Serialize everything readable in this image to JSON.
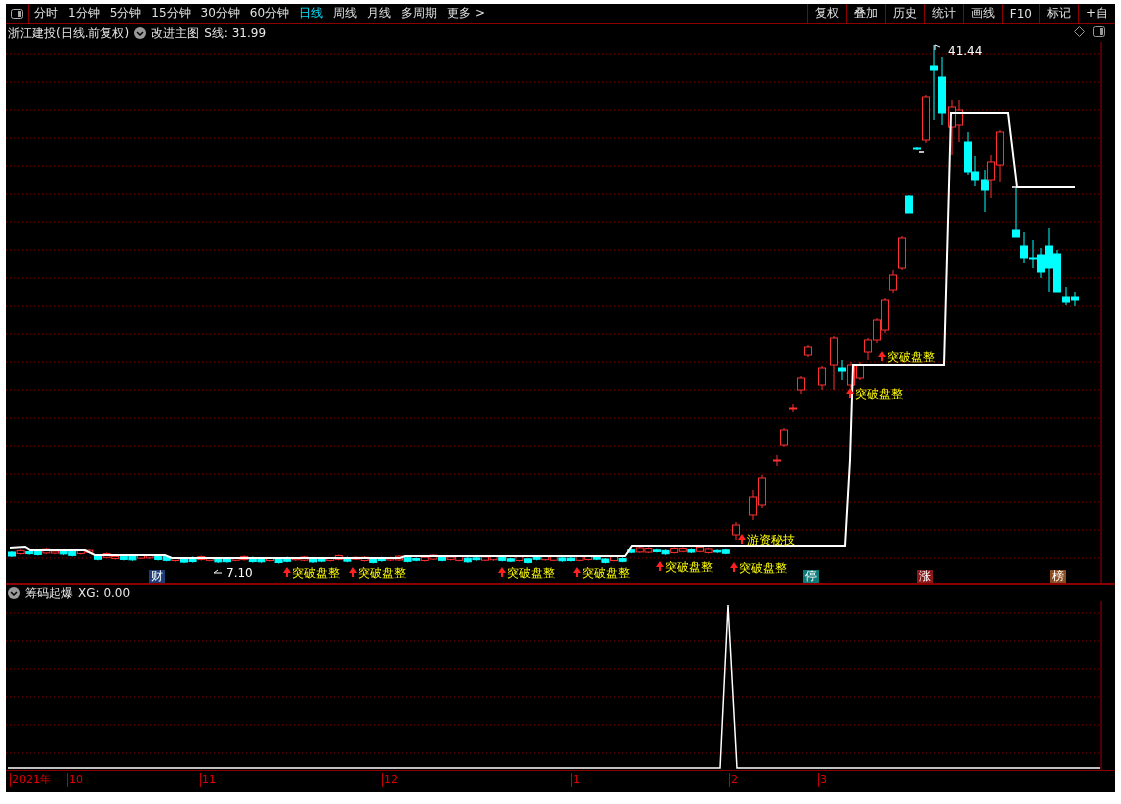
{
  "toolbar": {
    "periods": [
      {
        "label": "分时",
        "selected": false
      },
      {
        "label": "1分钟",
        "selected": false
      },
      {
        "label": "5分钟",
        "selected": false
      },
      {
        "label": "15分钟",
        "selected": false
      },
      {
        "label": "30分钟",
        "selected": false
      },
      {
        "label": "60分钟",
        "selected": false
      },
      {
        "label": "日线",
        "selected": true
      },
      {
        "label": "周线",
        "selected": false
      },
      {
        "label": "月线",
        "selected": false
      },
      {
        "label": "多周期",
        "selected": false
      },
      {
        "label": "更多 >",
        "selected": false
      }
    ],
    "actions": [
      "复权",
      "叠加",
      "历史",
      "统计",
      "画线",
      "F10",
      "标记",
      "+自"
    ]
  },
  "main_chart": {
    "stock": "浙江建投(日线.前复权)",
    "formula": "改进主图",
    "reading": "S线: 31.99",
    "high_label": "41.44",
    "low_label": "7.10",
    "signals": [
      {
        "label": "突破盘整"
      },
      {
        "label": "突破盘整"
      },
      {
        "label": "突破盘整"
      },
      {
        "label": "突破盘整"
      },
      {
        "label": "突破盘整"
      },
      {
        "label": "游资秘技"
      },
      {
        "label": "突破盘整"
      },
      {
        "label": "突破盘整"
      },
      {
        "label": "突破盘整"
      }
    ],
    "markers": [
      {
        "label": "财",
        "color": "#1c3d78"
      },
      {
        "label": "停",
        "color": "#0e7b7b"
      },
      {
        "label": "涨",
        "color": "#8a1a1a"
      },
      {
        "label": "榜",
        "color": "#8a4b1e"
      }
    ]
  },
  "indicator": {
    "name": "筹码起爆",
    "reading": "XG: 0.00"
  },
  "time_axis": [
    "2021年",
    "10",
    "11",
    "12",
    "1",
    "2",
    "3"
  ]
}
